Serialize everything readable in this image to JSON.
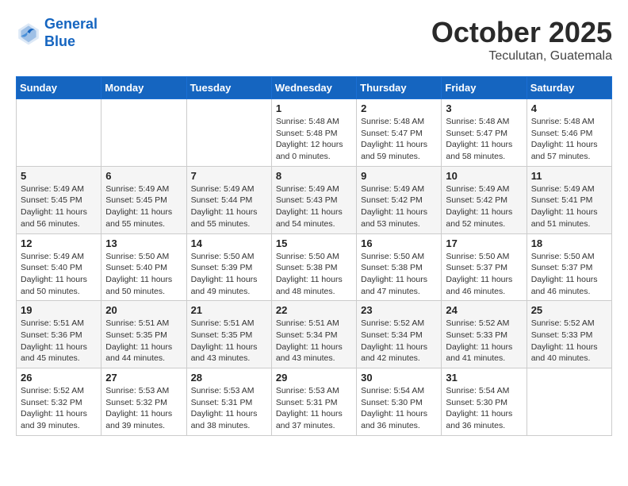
{
  "header": {
    "logo_line1": "General",
    "logo_line2": "Blue",
    "month": "October 2025",
    "location": "Teculutan, Guatemala"
  },
  "weekdays": [
    "Sunday",
    "Monday",
    "Tuesday",
    "Wednesday",
    "Thursday",
    "Friday",
    "Saturday"
  ],
  "weeks": [
    [
      {
        "day": "",
        "info": ""
      },
      {
        "day": "",
        "info": ""
      },
      {
        "day": "",
        "info": ""
      },
      {
        "day": "1",
        "info": "Sunrise: 5:48 AM\nSunset: 5:48 PM\nDaylight: 12 hours\nand 0 minutes."
      },
      {
        "day": "2",
        "info": "Sunrise: 5:48 AM\nSunset: 5:47 PM\nDaylight: 11 hours\nand 59 minutes."
      },
      {
        "day": "3",
        "info": "Sunrise: 5:48 AM\nSunset: 5:47 PM\nDaylight: 11 hours\nand 58 minutes."
      },
      {
        "day": "4",
        "info": "Sunrise: 5:48 AM\nSunset: 5:46 PM\nDaylight: 11 hours\nand 57 minutes."
      }
    ],
    [
      {
        "day": "5",
        "info": "Sunrise: 5:49 AM\nSunset: 5:45 PM\nDaylight: 11 hours\nand 56 minutes."
      },
      {
        "day": "6",
        "info": "Sunrise: 5:49 AM\nSunset: 5:45 PM\nDaylight: 11 hours\nand 55 minutes."
      },
      {
        "day": "7",
        "info": "Sunrise: 5:49 AM\nSunset: 5:44 PM\nDaylight: 11 hours\nand 55 minutes."
      },
      {
        "day": "8",
        "info": "Sunrise: 5:49 AM\nSunset: 5:43 PM\nDaylight: 11 hours\nand 54 minutes."
      },
      {
        "day": "9",
        "info": "Sunrise: 5:49 AM\nSunset: 5:42 PM\nDaylight: 11 hours\nand 53 minutes."
      },
      {
        "day": "10",
        "info": "Sunrise: 5:49 AM\nSunset: 5:42 PM\nDaylight: 11 hours\nand 52 minutes."
      },
      {
        "day": "11",
        "info": "Sunrise: 5:49 AM\nSunset: 5:41 PM\nDaylight: 11 hours\nand 51 minutes."
      }
    ],
    [
      {
        "day": "12",
        "info": "Sunrise: 5:49 AM\nSunset: 5:40 PM\nDaylight: 11 hours\nand 50 minutes."
      },
      {
        "day": "13",
        "info": "Sunrise: 5:50 AM\nSunset: 5:40 PM\nDaylight: 11 hours\nand 50 minutes."
      },
      {
        "day": "14",
        "info": "Sunrise: 5:50 AM\nSunset: 5:39 PM\nDaylight: 11 hours\nand 49 minutes."
      },
      {
        "day": "15",
        "info": "Sunrise: 5:50 AM\nSunset: 5:38 PM\nDaylight: 11 hours\nand 48 minutes."
      },
      {
        "day": "16",
        "info": "Sunrise: 5:50 AM\nSunset: 5:38 PM\nDaylight: 11 hours\nand 47 minutes."
      },
      {
        "day": "17",
        "info": "Sunrise: 5:50 AM\nSunset: 5:37 PM\nDaylight: 11 hours\nand 46 minutes."
      },
      {
        "day": "18",
        "info": "Sunrise: 5:50 AM\nSunset: 5:37 PM\nDaylight: 11 hours\nand 46 minutes."
      }
    ],
    [
      {
        "day": "19",
        "info": "Sunrise: 5:51 AM\nSunset: 5:36 PM\nDaylight: 11 hours\nand 45 minutes."
      },
      {
        "day": "20",
        "info": "Sunrise: 5:51 AM\nSunset: 5:35 PM\nDaylight: 11 hours\nand 44 minutes."
      },
      {
        "day": "21",
        "info": "Sunrise: 5:51 AM\nSunset: 5:35 PM\nDaylight: 11 hours\nand 43 minutes."
      },
      {
        "day": "22",
        "info": "Sunrise: 5:51 AM\nSunset: 5:34 PM\nDaylight: 11 hours\nand 43 minutes."
      },
      {
        "day": "23",
        "info": "Sunrise: 5:52 AM\nSunset: 5:34 PM\nDaylight: 11 hours\nand 42 minutes."
      },
      {
        "day": "24",
        "info": "Sunrise: 5:52 AM\nSunset: 5:33 PM\nDaylight: 11 hours\nand 41 minutes."
      },
      {
        "day": "25",
        "info": "Sunrise: 5:52 AM\nSunset: 5:33 PM\nDaylight: 11 hours\nand 40 minutes."
      }
    ],
    [
      {
        "day": "26",
        "info": "Sunrise: 5:52 AM\nSunset: 5:32 PM\nDaylight: 11 hours\nand 39 minutes."
      },
      {
        "day": "27",
        "info": "Sunrise: 5:53 AM\nSunset: 5:32 PM\nDaylight: 11 hours\nand 39 minutes."
      },
      {
        "day": "28",
        "info": "Sunrise: 5:53 AM\nSunset: 5:31 PM\nDaylight: 11 hours\nand 38 minutes."
      },
      {
        "day": "29",
        "info": "Sunrise: 5:53 AM\nSunset: 5:31 PM\nDaylight: 11 hours\nand 37 minutes."
      },
      {
        "day": "30",
        "info": "Sunrise: 5:54 AM\nSunset: 5:30 PM\nDaylight: 11 hours\nand 36 minutes."
      },
      {
        "day": "31",
        "info": "Sunrise: 5:54 AM\nSunset: 5:30 PM\nDaylight: 11 hours\nand 36 minutes."
      },
      {
        "day": "",
        "info": ""
      }
    ]
  ]
}
